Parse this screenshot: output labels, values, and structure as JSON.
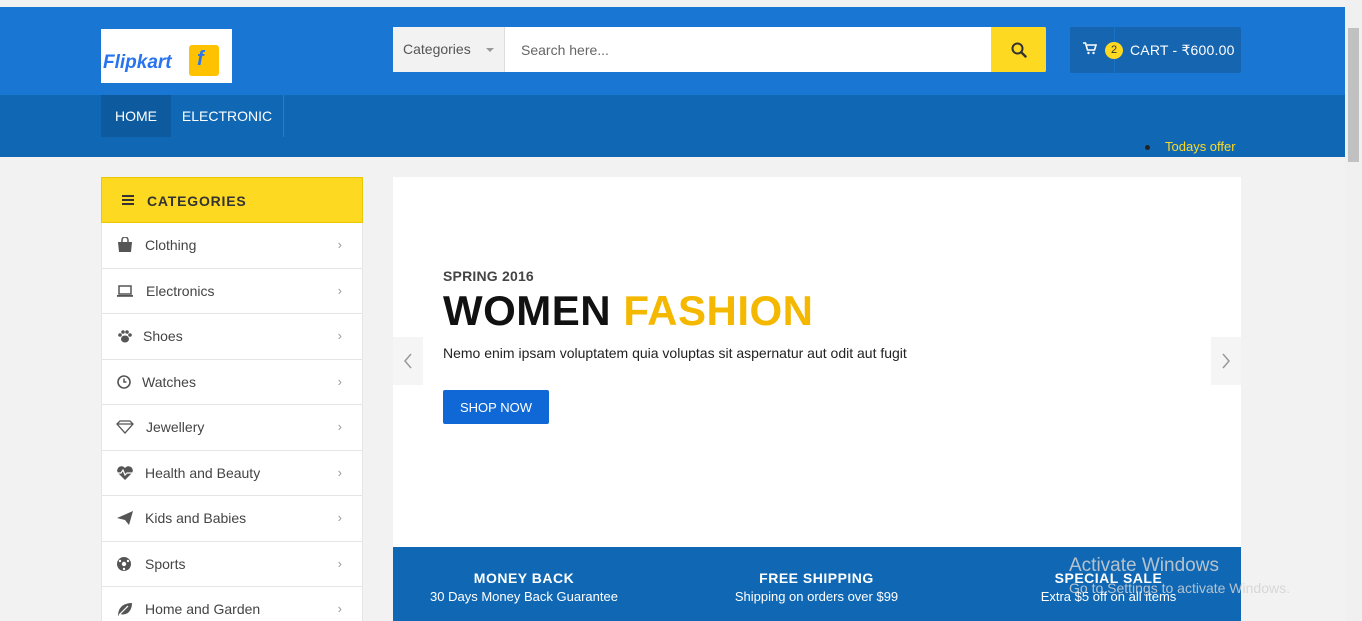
{
  "brand": {
    "logo_text": "Flipkart",
    "logo_mark": "f",
    "primary_color": "#1976d2",
    "accent_color": "#fdd922"
  },
  "search": {
    "category_label": "Categories",
    "placeholder": "Search here...",
    "icon": "search-icon"
  },
  "cart": {
    "count": "2",
    "label": "CART - ₹600.00",
    "icon": "cart-icon"
  },
  "nav": {
    "items": [
      {
        "label": "HOME"
      },
      {
        "label": "ELECTRONIC"
      }
    ],
    "offer": "Todays offer"
  },
  "sidebar": {
    "title": "CATEGORIES",
    "items": [
      {
        "label": "Clothing",
        "icon": "shopping-bag-icon"
      },
      {
        "label": "Electronics",
        "icon": "laptop-icon"
      },
      {
        "label": "Shoes",
        "icon": "paw-icon"
      },
      {
        "label": "Watches",
        "icon": "clock-icon"
      },
      {
        "label": "Jewellery",
        "icon": "diamond-icon"
      },
      {
        "label": "Health and Beauty",
        "icon": "heartbeat-icon"
      },
      {
        "label": "Kids and Babies",
        "icon": "paper-plane-icon"
      },
      {
        "label": "Sports",
        "icon": "soccer-ball-icon"
      },
      {
        "label": "Home and Garden",
        "icon": "leaf-icon"
      }
    ]
  },
  "banner": {
    "subtitle": "SPRING 2016",
    "title_part1": "WOMEN",
    "title_part2": "FASHION",
    "description": "Nemo enim ipsam voluptatem quia voluptas sit aspernatur aut odit aut fugit",
    "cta": "SHOP NOW"
  },
  "features": [
    {
      "title": "MONEY BACK",
      "text": "30 Days Money Back Guarantee"
    },
    {
      "title": "FREE SHIPPING",
      "text": "Shipping on orders over $99"
    },
    {
      "title": "SPECIAL SALE",
      "text": "Extra $5 off on all items"
    }
  ],
  "watermark": {
    "line1": "Activate Windows",
    "line2": "Go to Settings to activate Windows."
  }
}
